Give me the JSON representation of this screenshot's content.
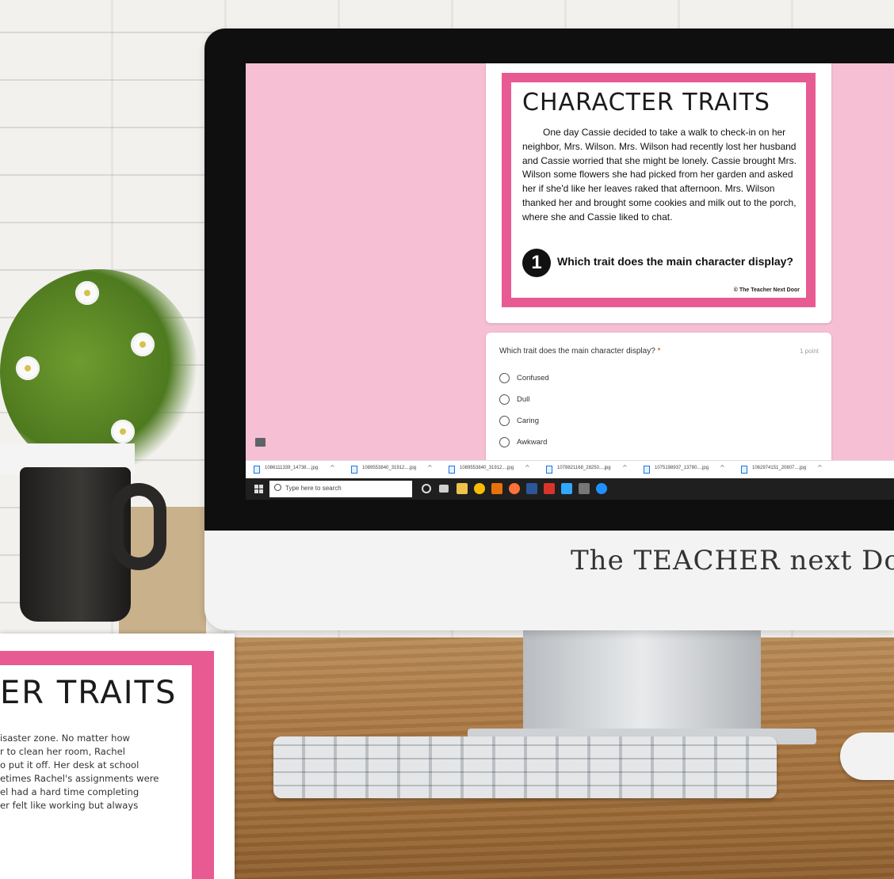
{
  "worksheet": {
    "title": "CHARACTER TRAITS",
    "passage": "One day Cassie decided to take a walk to check-in on her neighbor, Mrs. Wilson. Mrs. Wilson had recently lost her husband and Cassie worried that she might be lonely. Cassie brought Mrs. Wilson some flowers she had picked from her garden and asked her if she'd like her leaves raked that afternoon. Mrs. Wilson thanked her and brought some cookies and milk out to the porch, where she and Cassie liked to chat.",
    "question_number": "1",
    "question": "Which trait does the main character display?",
    "copyright": "© The Teacher Next Door"
  },
  "form": {
    "question": "Which trait does the main character display?",
    "required_mark": "*",
    "points": "1 point",
    "options": [
      "Confused",
      "Dull",
      "Caring",
      "Awkward"
    ]
  },
  "downloads": [
    "1086111339_14738....jpg",
    "1089553840_31912....jpg",
    "1089553840_31912....jpg",
    "1078821168_28250....jpg",
    "1075198937_13780....jpg",
    "1062974151_20807....jpg"
  ],
  "taskbar": {
    "search_placeholder": "Type here to search"
  },
  "brand": {
    "logo_text": "The TEACHER next Door"
  },
  "card2": {
    "title": "ER TRAITS",
    "text": "isaster zone. No matter how\nr to clean her room, Rachel\no put it off. Her desk at school\netimes Rachel's assignments were\nel had a hard time completing\ner felt like working but always"
  },
  "colors": {
    "screen_bg": "#f6bfd4",
    "frame_pink": "#e85a92",
    "taskbar": "#1f1f1f"
  }
}
